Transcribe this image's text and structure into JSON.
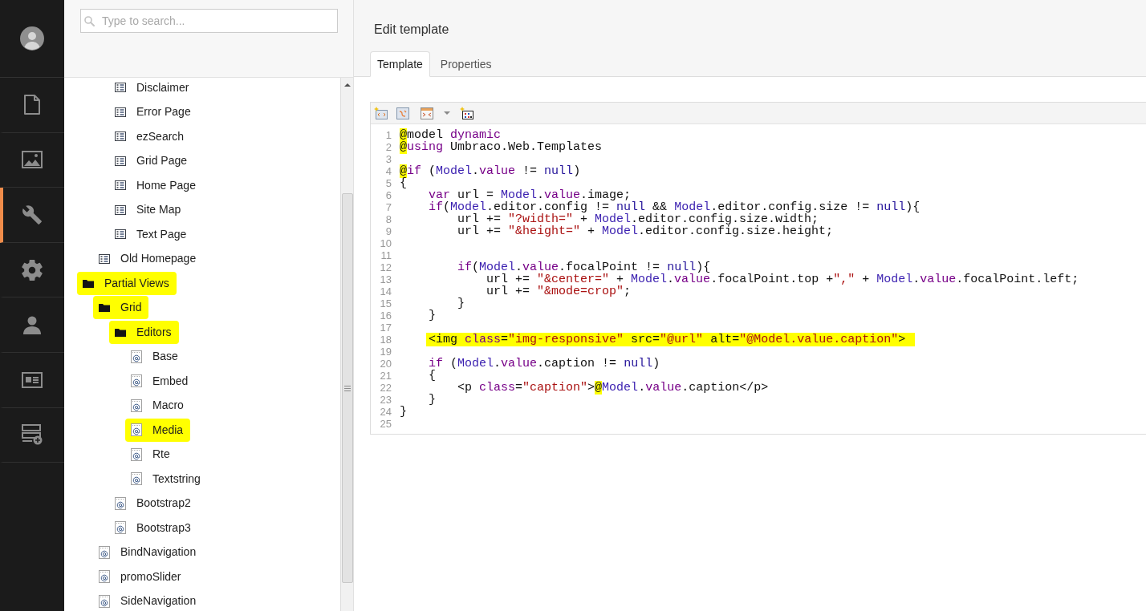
{
  "nav": {
    "sections": [
      {
        "selected": false
      },
      {
        "selected": false
      },
      {
        "selected": true
      },
      {
        "selected": false
      },
      {
        "selected": false
      },
      {
        "selected": false
      },
      {
        "selected": false
      }
    ]
  },
  "tree_panel": {
    "search": {
      "placeholder": "Type to search..."
    },
    "tree": [
      {
        "children": [
          {
            "children": [
              {
                "label": "Disclaimer",
                "kind": "doctype",
                "highlighted": false
              },
              {
                "label": "Error Page",
                "kind": "doctype",
                "highlighted": false
              },
              {
                "label": "ezSearch",
                "kind": "doctype",
                "highlighted": false
              },
              {
                "label": "Grid Page",
                "kind": "doctype",
                "highlighted": false
              },
              {
                "label": "Home Page",
                "kind": "doctype",
                "highlighted": false
              },
              {
                "label": "Site Map",
                "kind": "doctype",
                "highlighted": false
              },
              {
                "label": "Text Page",
                "kind": "doctype",
                "highlighted": false
              }
            ]
          },
          {
            "label": "Old Homepage",
            "kind": "doctype",
            "highlighted": false
          }
        ]
      },
      {
        "label": "Partial Views",
        "kind": "folder",
        "highlighted": true,
        "children": [
          {
            "label": "Grid",
            "kind": "folder",
            "highlighted": true,
            "children": [
              {
                "label": "Editors",
                "kind": "folder",
                "highlighted": true,
                "children": [
                  {
                    "label": "Base",
                    "kind": "razor",
                    "highlighted": false
                  },
                  {
                    "label": "Embed",
                    "kind": "razor",
                    "highlighted": false
                  },
                  {
                    "label": "Macro",
                    "kind": "razor",
                    "highlighted": false
                  },
                  {
                    "label": "Media",
                    "kind": "razor",
                    "highlighted": true
                  },
                  {
                    "label": "Rte",
                    "kind": "razor",
                    "highlighted": false
                  },
                  {
                    "label": "Textstring",
                    "kind": "razor",
                    "highlighted": false
                  }
                ]
              },
              {
                "label": "Bootstrap2",
                "kind": "razor",
                "highlighted": false
              },
              {
                "label": "Bootstrap3",
                "kind": "razor",
                "highlighted": false
              }
            ]
          },
          {
            "label": "BindNavigation",
            "kind": "razor",
            "highlighted": false
          },
          {
            "label": "promoSlider",
            "kind": "razor",
            "highlighted": false
          },
          {
            "label": "SideNavigation",
            "kind": "razor",
            "highlighted": false
          }
        ]
      }
    ]
  },
  "editor": {
    "title": "Edit template",
    "tabs": [
      {
        "label": "Template",
        "selected": true
      },
      {
        "label": "Properties",
        "selected": false
      }
    ],
    "code": {
      "lines": [
        {
          "number": "1",
          "highlighted": false,
          "tokens": [
            {
              "kind": "marker",
              "text": "@"
            },
            {
              "kind": "plain",
              "text": "model "
            },
            {
              "kind": "keyword",
              "text": "dynamic"
            }
          ]
        },
        {
          "number": "2",
          "highlighted": false,
          "tokens": [
            {
              "kind": "marker",
              "text": "@"
            },
            {
              "kind": "keyword",
              "text": "using"
            },
            {
              "kind": "plain",
              "text": " Umbraco.Web.Templates"
            }
          ]
        },
        {
          "number": "3",
          "highlighted": false
        },
        {
          "number": "4",
          "highlighted": false,
          "tokens": [
            {
              "kind": "marker",
              "text": "@"
            },
            {
              "kind": "keyword",
              "text": "if"
            },
            {
              "kind": "plain",
              "text": " ("
            },
            {
              "kind": "model",
              "text": "Model"
            },
            {
              "kind": "plain",
              "text": "."
            },
            {
              "kind": "keyword",
              "text": "value"
            },
            {
              "kind": "plain",
              "text": " != "
            },
            {
              "kind": "null",
              "text": "null"
            },
            {
              "kind": "plain",
              "text": ")"
            }
          ]
        },
        {
          "number": "5",
          "highlighted": false,
          "tokens": [
            {
              "kind": "plain",
              "text": "{"
            }
          ]
        },
        {
          "number": "6",
          "highlighted": false,
          "tokens": [
            {
              "kind": "keyword",
              "text": "    var"
            },
            {
              "kind": "plain",
              "text": " url = "
            },
            {
              "kind": "model",
              "text": "Model"
            },
            {
              "kind": "plain",
              "text": "."
            },
            {
              "kind": "keyword",
              "text": "value"
            },
            {
              "kind": "plain",
              "text": ".image;"
            }
          ]
        },
        {
          "number": "7",
          "highlighted": false,
          "tokens": [
            {
              "kind": "keyword",
              "text": "    if"
            },
            {
              "kind": "plain",
              "text": "("
            },
            {
              "kind": "model",
              "text": "Model"
            },
            {
              "kind": "plain",
              "text": ".editor.config != "
            },
            {
              "kind": "null",
              "text": "null"
            },
            {
              "kind": "plain",
              "text": " && "
            },
            {
              "kind": "model",
              "text": "Model"
            },
            {
              "kind": "plain",
              "text": ".editor.config.size != "
            },
            {
              "kind": "null",
              "text": "null"
            },
            {
              "kind": "plain",
              "text": "){"
            }
          ]
        },
        {
          "number": "8",
          "highlighted": false,
          "tokens": [
            {
              "kind": "plain",
              "text": "        url += "
            },
            {
              "kind": "string",
              "text": "\"?width=\""
            },
            {
              "kind": "plain",
              "text": " + "
            },
            {
              "kind": "model",
              "text": "Model"
            },
            {
              "kind": "plain",
              "text": ".editor.config.size.width;"
            }
          ]
        },
        {
          "number": "9",
          "highlighted": false,
          "tokens": [
            {
              "kind": "plain",
              "text": "        url += "
            },
            {
              "kind": "string",
              "text": "\"&height=\""
            },
            {
              "kind": "plain",
              "text": " + "
            },
            {
              "kind": "model",
              "text": "Model"
            },
            {
              "kind": "plain",
              "text": ".editor.config.size.height;"
            }
          ]
        },
        {
          "number": "10",
          "highlighted": false
        },
        {
          "number": "11",
          "highlighted": false
        },
        {
          "number": "12",
          "highlighted": false,
          "tokens": [
            {
              "kind": "keyword",
              "text": "        if"
            },
            {
              "kind": "plain",
              "text": "("
            },
            {
              "kind": "model",
              "text": "Model"
            },
            {
              "kind": "plain",
              "text": "."
            },
            {
              "kind": "keyword",
              "text": "value"
            },
            {
              "kind": "plain",
              "text": ".focalPoint != "
            },
            {
              "kind": "null",
              "text": "null"
            },
            {
              "kind": "plain",
              "text": "){"
            }
          ]
        },
        {
          "number": "13",
          "highlighted": false,
          "tokens": [
            {
              "kind": "plain",
              "text": "            url += "
            },
            {
              "kind": "string",
              "text": "\"&center=\""
            },
            {
              "kind": "plain",
              "text": " + "
            },
            {
              "kind": "model",
              "text": "Model"
            },
            {
              "kind": "plain",
              "text": "."
            },
            {
              "kind": "keyword",
              "text": "value"
            },
            {
              "kind": "plain",
              "text": ".focalPoint.top +"
            },
            {
              "kind": "string",
              "text": "\",\""
            },
            {
              "kind": "plain",
              "text": " + "
            },
            {
              "kind": "model",
              "text": "Model"
            },
            {
              "kind": "plain",
              "text": "."
            },
            {
              "kind": "keyword",
              "text": "value"
            },
            {
              "kind": "plain",
              "text": ".focalPoint.left;"
            }
          ]
        },
        {
          "number": "14",
          "highlighted": false,
          "tokens": [
            {
              "kind": "plain",
              "text": "            url += "
            },
            {
              "kind": "string",
              "text": "\"&mode=crop\""
            },
            {
              "kind": "plain",
              "text": ";"
            }
          ]
        },
        {
          "number": "15",
          "highlighted": false,
          "tokens": [
            {
              "kind": "plain",
              "text": "        }"
            }
          ]
        },
        {
          "number": "16",
          "highlighted": false,
          "tokens": [
            {
              "kind": "plain",
              "text": "    }"
            }
          ]
        },
        {
          "number": "17",
          "highlighted": false
        },
        {
          "number": "18",
          "highlighted": true,
          "tokens": [
            {
              "kind": "plain",
              "text": "    <img "
            },
            {
              "kind": "keyword",
              "text": "class"
            },
            {
              "kind": "plain",
              "text": "="
            },
            {
              "kind": "string",
              "text": "\"img-responsive\""
            },
            {
              "kind": "plain",
              "text": " src="
            },
            {
              "kind": "string",
              "text": "\"@url\""
            },
            {
              "kind": "plain",
              "text": " alt="
            },
            {
              "kind": "string",
              "text": "\"@Model.value.caption\""
            },
            {
              "kind": "plain",
              "text": ">"
            }
          ]
        },
        {
          "number": "19",
          "highlighted": false
        },
        {
          "number": "20",
          "highlighted": false,
          "tokens": [
            {
              "kind": "keyword",
              "text": "    if"
            },
            {
              "kind": "plain",
              "text": " ("
            },
            {
              "kind": "model",
              "text": "Model"
            },
            {
              "kind": "plain",
              "text": "."
            },
            {
              "kind": "keyword",
              "text": "value"
            },
            {
              "kind": "plain",
              "text": ".caption != "
            },
            {
              "kind": "null",
              "text": "null"
            },
            {
              "kind": "plain",
              "text": ")"
            }
          ]
        },
        {
          "number": "21",
          "highlighted": false,
          "tokens": [
            {
              "kind": "plain",
              "text": "    {"
            }
          ]
        },
        {
          "number": "22",
          "highlighted": false,
          "tokens": [
            {
              "kind": "plain",
              "text": "        <p "
            },
            {
              "kind": "keyword",
              "text": "class"
            },
            {
              "kind": "plain",
              "text": "="
            },
            {
              "kind": "string",
              "text": "\"caption\""
            },
            {
              "kind": "plain",
              "text": ">"
            },
            {
              "kind": "marker",
              "text": "@"
            },
            {
              "kind": "model",
              "text": "Model"
            },
            {
              "kind": "plain",
              "text": "."
            },
            {
              "kind": "keyword",
              "text": "value"
            },
            {
              "kind": "plain",
              "text": ".caption</p>"
            }
          ]
        },
        {
          "number": "23",
          "highlighted": false,
          "tokens": [
            {
              "kind": "plain",
              "text": "    }"
            }
          ]
        },
        {
          "number": "24",
          "highlighted": false,
          "tokens": [
            {
              "kind": "plain",
              "text": "}"
            }
          ]
        },
        {
          "number": "25",
          "highlighted": false
        }
      ]
    }
  }
}
